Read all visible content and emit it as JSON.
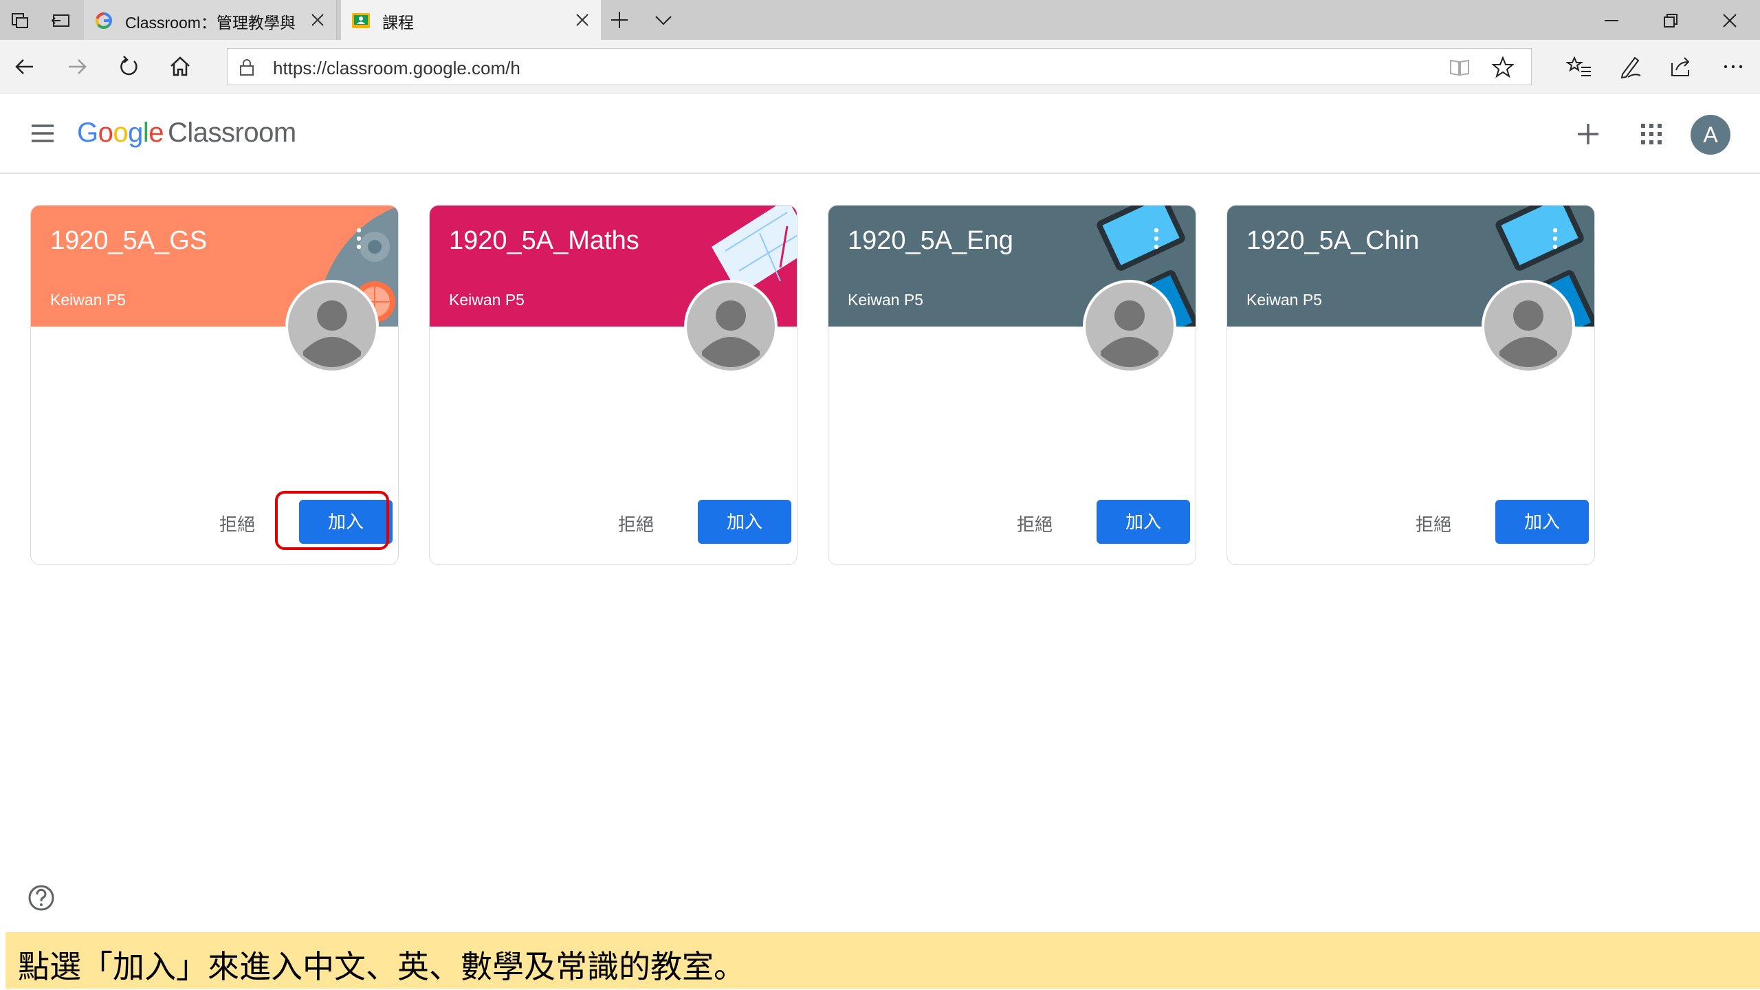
{
  "browser": {
    "tabs": [
      {
        "title": "Classroom：管理教學與",
        "favicon": "google-g-icon",
        "active": false
      },
      {
        "title": "課程",
        "favicon": "classroom-icon",
        "active": true
      }
    ],
    "url": "https://classroom.google.com/h"
  },
  "app": {
    "logo_google_letters": [
      "G",
      "o",
      "o",
      "g",
      "l",
      "e"
    ],
    "logo_product": "Classroom",
    "avatar_letter": "A",
    "brand_colors": {
      "blue": "#4285f4",
      "red": "#ea4335",
      "yellow": "#fbbc05",
      "green": "#34a853"
    },
    "accent_color": "#1a73e8"
  },
  "classes": [
    {
      "name": "1920_5A_GS",
      "section": "Keiwan P5",
      "decline_label": "拒絕",
      "join_label": "加入",
      "color": "#ff8a65",
      "highlighted": true
    },
    {
      "name": "1920_5A_Maths",
      "section": "Keiwan P5",
      "decline_label": "拒絕",
      "join_label": "加入",
      "color": "#d81b60",
      "highlighted": false
    },
    {
      "name": "1920_5A_Eng",
      "section": "Keiwan P5",
      "decline_label": "拒絕",
      "join_label": "加入",
      "color": "#546e7a",
      "highlighted": false
    },
    {
      "name": "1920_5A_Chin",
      "section": "Keiwan P5",
      "decline_label": "拒絕",
      "join_label": "加入",
      "color": "#546e7a",
      "highlighted": false
    }
  ],
  "caption": {
    "text": "點選「加入」來進入中文、英、數學及常識的教室。",
    "background": "#ffe699"
  }
}
